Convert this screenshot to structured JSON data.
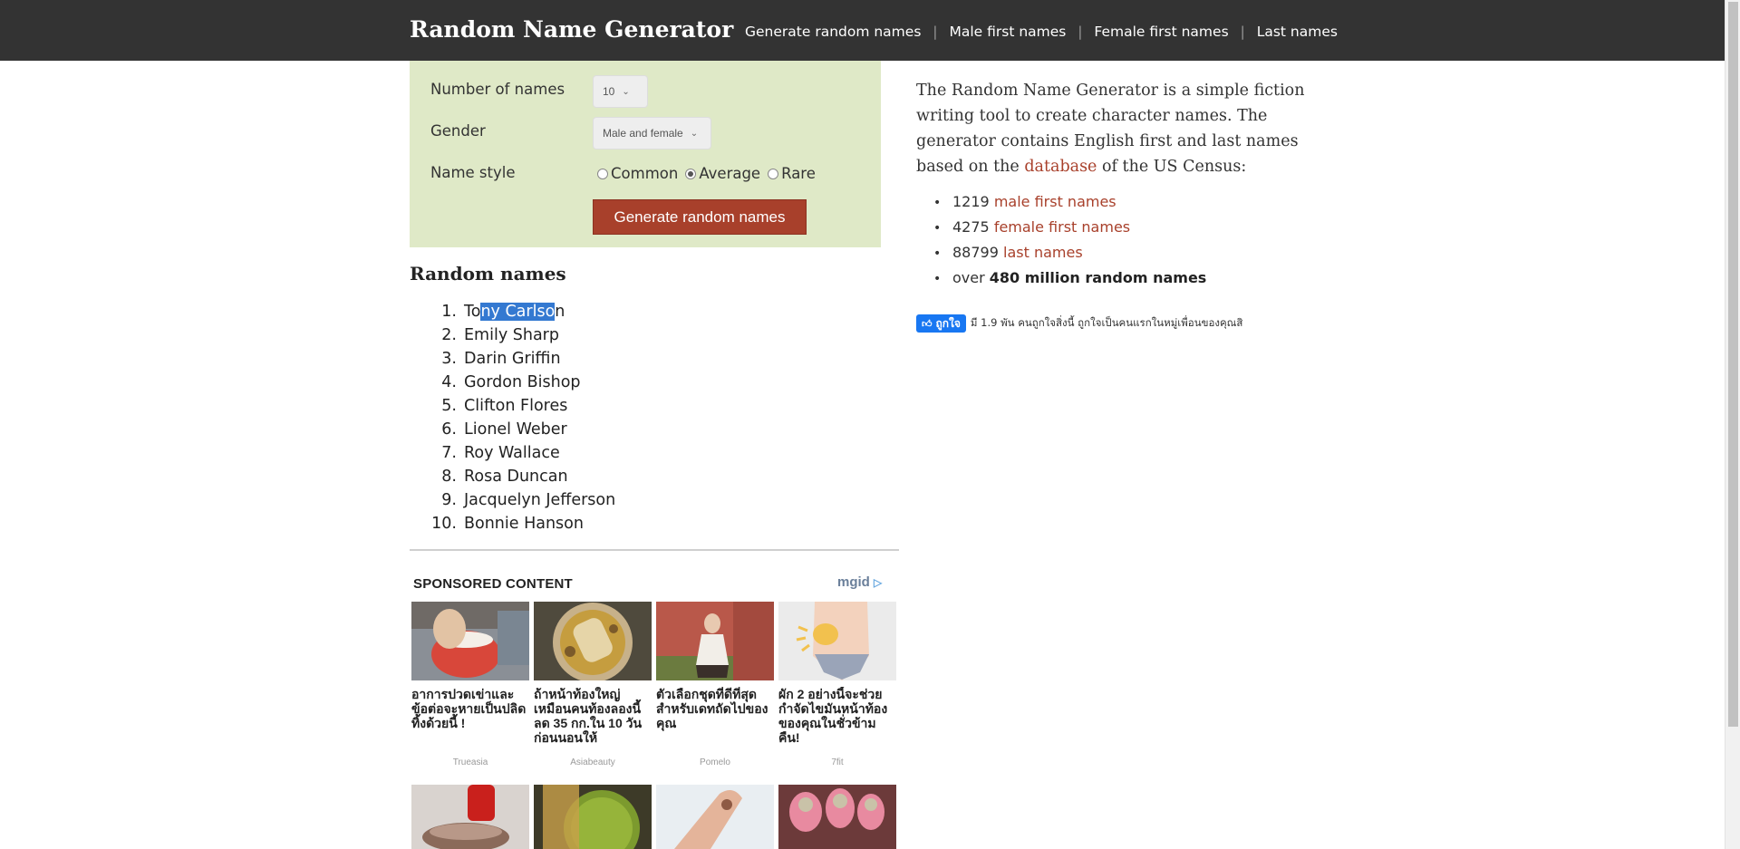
{
  "header": {
    "brand": "Random Name Generator",
    "nav": [
      {
        "label": "Generate random names"
      },
      {
        "label": "Male first names"
      },
      {
        "label": "Female first names"
      },
      {
        "label": "Last names"
      }
    ],
    "separator": "|"
  },
  "form": {
    "number_label": "Number of names",
    "number_value": "10",
    "gender_label": "Gender",
    "gender_value": "Male and female",
    "style_label": "Name style",
    "style_options": [
      "Common",
      "Average",
      "Rare"
    ],
    "style_selected": "Average",
    "generate_label": "Generate random names"
  },
  "results": {
    "title": "Random names",
    "names": [
      "Tony Carlson",
      "Emily Sharp",
      "Darin Griffin",
      "Gordon Bishop",
      "Clifton Flores",
      "Lionel Weber",
      "Roy Wallace",
      "Rosa Duncan",
      "Jacquelyn Jefferson",
      "Bonnie Hanson"
    ],
    "first_name_parts": {
      "before": "To",
      "selected": "ny Carlso",
      "after": "n"
    }
  },
  "sponsored": {
    "title": "SPONSORED CONTENT",
    "logo": "mgid",
    "cards": [
      {
        "title": "อาการปวดเข่าและข้อต่อจะหายเป็นปลิดทิ้งด้วยนี้ !",
        "source": "Trueasia"
      },
      {
        "title": "ถ้าหน้าท้องใหญ่เหมือนคนท้องลองนี้ ลด 35 กก.ใน 10 วัน ก่อนนอนให้",
        "source": "Asiabeauty"
      },
      {
        "title": "ตัวเลือกชุดที่ดีที่สุดสำหรับเดทถัดไปของคุณ",
        "source": "Pomelo"
      },
      {
        "title": "ผัก 2 อย่างนี้จะช่วยกำจัดไขมันหน้าท้องของคุณในชั่วข้ามคืน!",
        "source": "7fit"
      }
    ]
  },
  "info": {
    "intro_before_link": "The Random Name Generator is a simple fiction writing tool to create character names. The generator contains English first and last names based on the ",
    "intro_link": "database",
    "intro_after_link": " of the US Census:",
    "stats": [
      {
        "count": "1219",
        "link": "male first names"
      },
      {
        "count": "4275",
        "link": "female first names"
      },
      {
        "count": "88799",
        "link": "last names"
      }
    ],
    "stats_last_prefix": "over",
    "stats_last_bold": "480 million random names"
  },
  "facebook": {
    "like_label": "ถูกใจ",
    "like_text": "มี 1.9 พัน คนถูกใจสิ่งนี้ ถูกใจเป็นคนแรกในหมู่เพื่อนของคุณสิ"
  },
  "colors": {
    "header_bg": "#333333",
    "panel_bg": "#dfe9c7",
    "accent": "#a8402b",
    "link": "#a8402b",
    "selection": "#3479d1",
    "facebook": "#1877f2"
  }
}
